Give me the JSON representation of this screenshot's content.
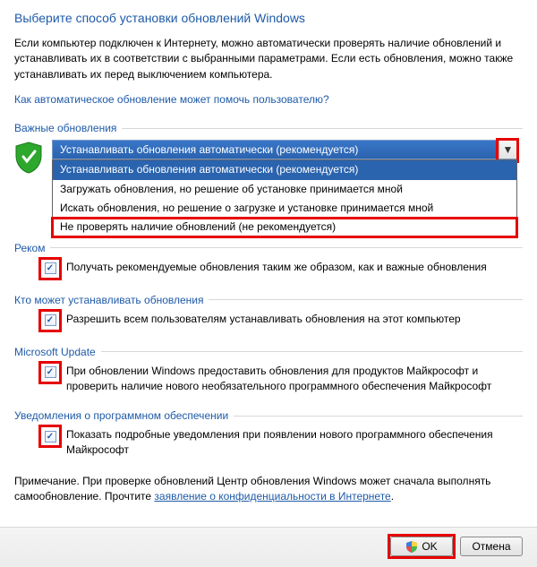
{
  "page": {
    "title": "Выберите способ установки обновлений Windows",
    "intro": "Если компьютер подключен к Интернету, можно автоматически проверять наличие обновлений и устанавливать их в соответствии с выбранными параметрами. Если есть обновления, можно также устанавливать их перед выключением компьютера.",
    "help_link": "Как автоматическое обновление может помочь пользователю?"
  },
  "sections": {
    "important": {
      "label": "Важные обновления",
      "dropdown": {
        "selected": "Устанавливать обновления автоматически (рекомендуется)",
        "options": [
          "Устанавливать обновления автоматически (рекомендуется)",
          "Загружать обновления, но решение об установке принимается мной",
          "Искать обновления, но решение о загрузке и установке принимается мной",
          "Не проверять наличие обновлений (не рекомендуется)"
        ]
      }
    },
    "recommended": {
      "label_partial": "Реком",
      "checkbox_text": "Получать рекомендуемые обновления таким же образом, как и важные обновления"
    },
    "who": {
      "label": "Кто может устанавливать обновления",
      "checkbox_text": "Разрешить всем пользователям устанавливать обновления на этот компьютер"
    },
    "msupdate": {
      "label": "Microsoft Update",
      "checkbox_text": "При обновлении Windows предоставить обновления для продуктов Майкрософт и проверить наличие нового необязательного программного обеспечения Майкрософт"
    },
    "notifications": {
      "label": "Уведомления о программном обеспечении",
      "checkbox_text": "Показать подробные уведомления при появлении нового программного обеспечения Майкрософт"
    }
  },
  "note": {
    "prefix": "Примечание. При проверке обновлений Центр обновления Windows может сначала выполнять самообновление. Прочтите ",
    "link": "заявление о конфиденциальности в Интернете",
    "suffix": "."
  },
  "buttons": {
    "ok": "OK",
    "cancel": "Отмена"
  },
  "icons": {
    "shield": "shield-icon",
    "uac": "uac-shield-icon",
    "chevron": "▼",
    "check": "✓"
  }
}
